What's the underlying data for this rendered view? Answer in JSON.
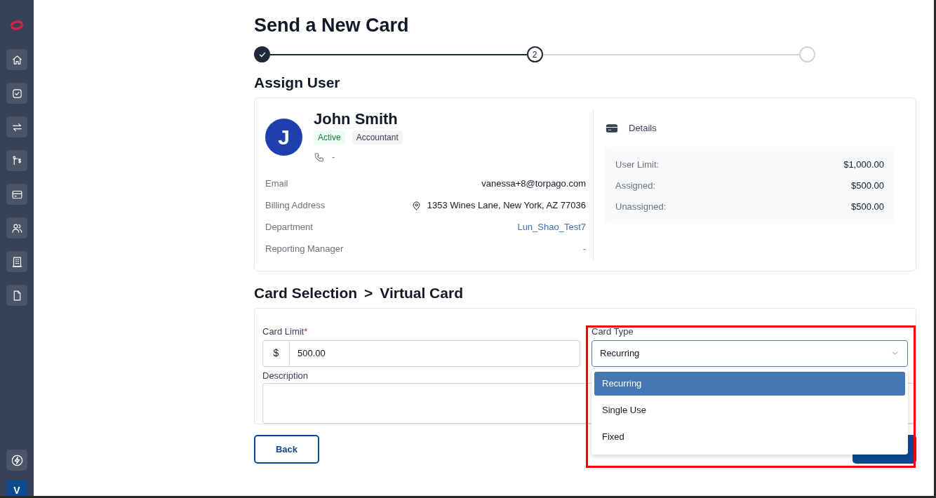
{
  "sidebar": {
    "items": [
      {
        "selected": false
      },
      {
        "selected": false
      },
      {
        "selected": false
      },
      {
        "selected": false
      },
      {
        "selected": false
      },
      {
        "selected": false
      },
      {
        "selected": false
      },
      {
        "selected": false
      }
    ],
    "avatar": "V"
  },
  "title": "Send a New Card",
  "stepper": [
    {
      "completed": true,
      "selected": false
    },
    {
      "completed": false,
      "selected": true,
      "label": "2"
    },
    {
      "completed": false,
      "selected": false
    }
  ],
  "assign_user": {
    "heading": "Assign User",
    "initial": "J",
    "name": "John Smith",
    "badges": [
      {
        "text": "Active",
        "kind": "status"
      },
      {
        "text": "Accountant",
        "kind": "role"
      }
    ],
    "phone": "-",
    "fields": [
      {
        "label": "Email",
        "value": "vanessa+8@torpago.com",
        "kind": "text"
      },
      {
        "label": "Billing Address",
        "value": "1353 Wines Lane, New York, AZ 77036",
        "kind": "address"
      },
      {
        "label": "Department",
        "value": "Lun_Shao_Test7",
        "kind": "link"
      },
      {
        "label": "Reporting Manager",
        "value": "-",
        "kind": "muted"
      }
    ],
    "details": {
      "title": "Details",
      "rows": [
        {
          "label": "User Limit:",
          "value": "$1,000.00"
        },
        {
          "label": "Assigned:",
          "value": "$500.00"
        },
        {
          "label": "Unassigned:",
          "value": "$500.00"
        }
      ]
    }
  },
  "card_selection": {
    "heading": "Card Selection",
    "separator": ">",
    "subheading": "Virtual Card",
    "card_limit": {
      "label": "Card Limit",
      "required_mark": "*",
      "prefix": "$",
      "value": "500.00"
    },
    "description": {
      "label": "Description"
    },
    "card_type": {
      "label": "Card Type",
      "value": "Recurring",
      "expanded": true,
      "options": [
        {
          "label": "Recurring",
          "selected": true
        },
        {
          "label": "Single Use",
          "selected": false
        },
        {
          "label": "Fixed",
          "selected": false
        }
      ]
    }
  },
  "buttons": {
    "back": "Back"
  },
  "highlight": true
}
